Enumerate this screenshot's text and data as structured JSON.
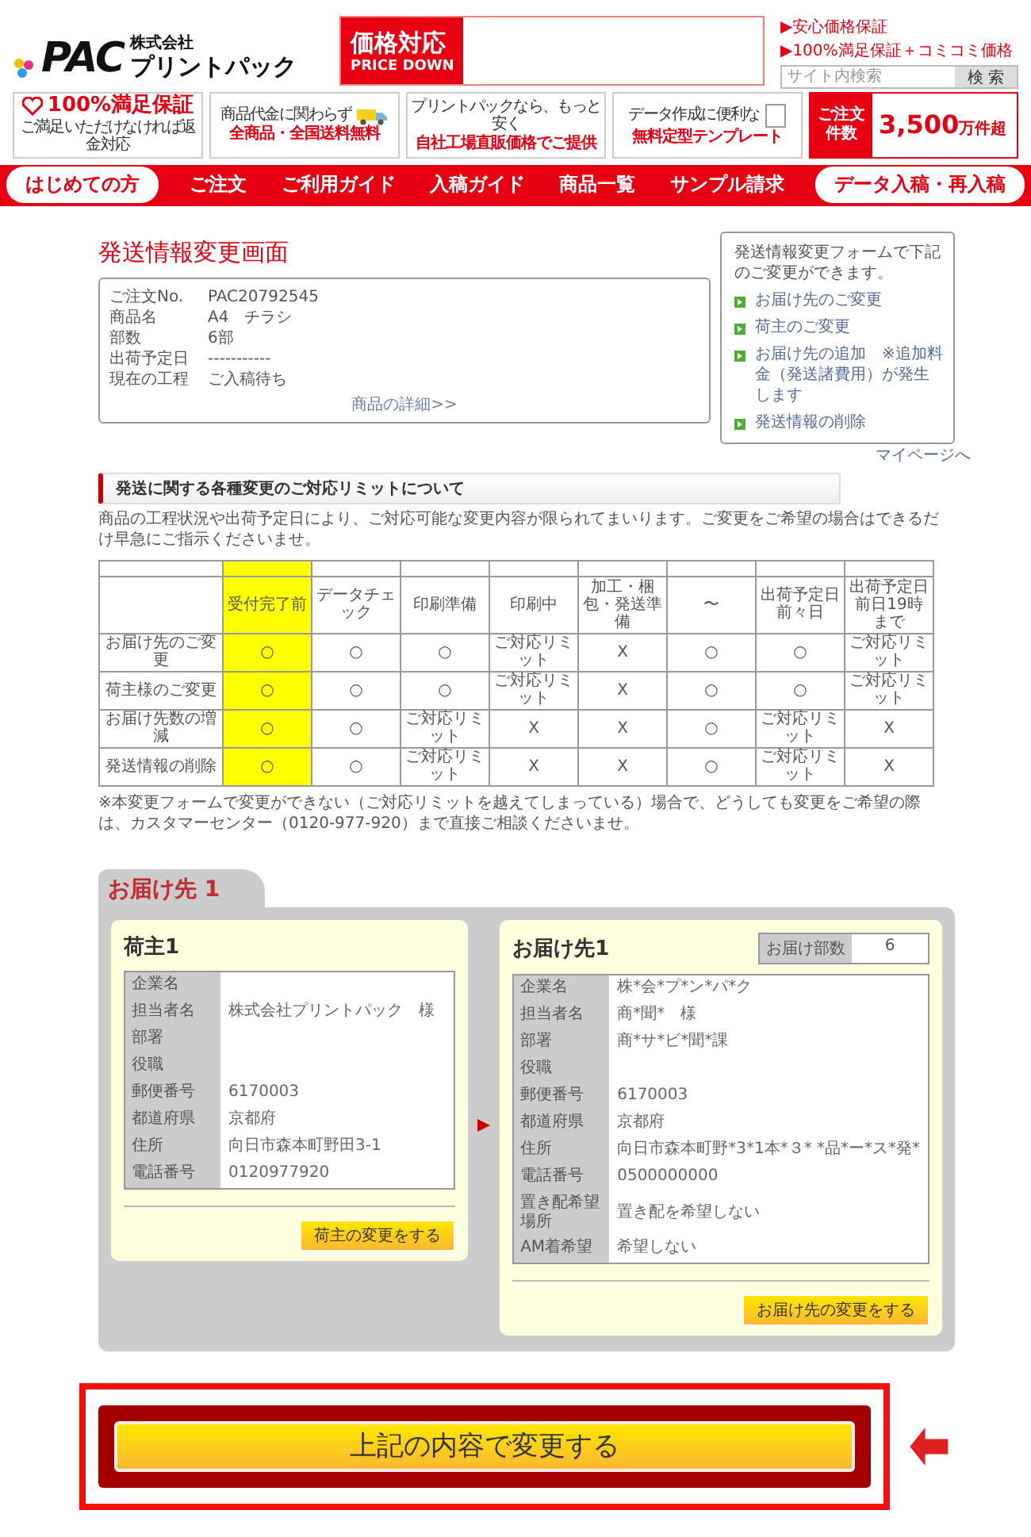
{
  "header": {
    "logo": {
      "company_type": "株式会社",
      "mark": "PAC",
      "name": "プリントパック"
    },
    "price_banner": {
      "title": "価格対応",
      "subtitle": "PRICE DOWN"
    },
    "links": [
      "▶安心価格保証",
      "▶100%満足保証＋コミコミ価格"
    ],
    "search": {
      "placeholder": "サイト内検索",
      "button": "検 索"
    }
  },
  "features": [
    {
      "kind": "guarantee",
      "title": "100%満足保証",
      "text": "ご満足いただけなければ返金対応"
    },
    {
      "kind": "shipping",
      "text": "商品代金に関わらず",
      "title": "全商品・全国送料無料"
    },
    {
      "kind": "price",
      "text": "プリントパックなら、もっと安く",
      "title": "**自社工場直販価格**でご提供"
    },
    {
      "kind": "template",
      "text": "データ作成に便利な",
      "title": "無料定型テンプレート"
    },
    {
      "kind": "orders",
      "label": "ご注文件数",
      "value": "3,500",
      "unit": "万件超"
    }
  ],
  "nav": [
    {
      "kind": "pill",
      "label": "はじめての方"
    },
    {
      "kind": "link",
      "label": "ご注文"
    },
    {
      "kind": "link",
      "label": "ご利用ガイド"
    },
    {
      "kind": "link",
      "label": "入稿ガイド"
    },
    {
      "kind": "link",
      "label": "商品一覧"
    },
    {
      "kind": "link",
      "label": "サンプル請求"
    },
    {
      "kind": "pill",
      "label": "データ入稿・再入稿"
    }
  ],
  "page_title": "発送情報変更画面",
  "order": {
    "rows": [
      {
        "label": "ご注文No.",
        "value": "PAC20792545"
      },
      {
        "label": "商品名",
        "value": "A4　チラシ"
      },
      {
        "label": "部数",
        "value": "6部"
      },
      {
        "label": "出荷予定日",
        "value": "-----------"
      },
      {
        "label": "現在の工程",
        "value": "ご入稿待ち"
      }
    ],
    "detail_link": "商品の詳細>>"
  },
  "side": {
    "intro": "発送情報変更フォームで下記のご変更ができます。",
    "items": [
      "お届け先のご変更",
      "荷主のご変更",
      "お届け先の追加　※追加料金（発送諸費用）が発生します",
      "発送情報の削除"
    ]
  },
  "mypage_link": "マイページへ",
  "section_heading": "発送に関する各種変更のご対応リミットについて",
  "note": "商品の工程状況や出荷予定日により、ご対応可能な変更内容が限られてまいります。ご変更をご希望の場合はできるだけ早急にご指示くださいませ。",
  "table": {
    "columns": [
      {
        "kind": "stage",
        "label": "受付完了前",
        "highlighted": true
      },
      {
        "kind": "stage",
        "label": "データチェック",
        "highlighted": false
      },
      {
        "kind": "stage",
        "label": "印刷準備",
        "highlighted": false
      },
      {
        "kind": "stage",
        "label": "印刷中",
        "highlighted": false
      },
      {
        "kind": "stage",
        "label": "加工・梱包・発送準備",
        "highlighted": false
      },
      {
        "kind": "stage",
        "label": "〜",
        "highlighted": false
      },
      {
        "kind": "stage",
        "label": "出荷予定日前々日",
        "highlighted": false
      },
      {
        "kind": "stage",
        "label": "出荷予定日前日19時まで",
        "highlighted": false
      }
    ],
    "rows": [
      {
        "label": "お届け先のご変更",
        "cells": [
          "○",
          "○",
          "○",
          "ご対応リミット",
          "X",
          "○",
          "○",
          "ご対応リミット"
        ]
      },
      {
        "label": "荷主様のご変更",
        "cells": [
          "○",
          "○",
          "○",
          "ご対応リミット",
          "X",
          "○",
          "○",
          "ご対応リミット"
        ]
      },
      {
        "label": "お届け先数の増減",
        "cells": [
          "○",
          "○",
          "ご対応リミット",
          "X",
          "X",
          "○",
          "ご対応リミット",
          "X"
        ]
      },
      {
        "label": "発送情報の削除",
        "cells": [
          "○",
          "○",
          "ご対応リミット",
          "X",
          "X",
          "○",
          "ご対応リミット",
          "X"
        ]
      }
    ]
  },
  "footnote": "※本変更フォームで変更ができない（ご対応リミットを越えてしまっている）場合で、どうしても変更をご希望の際は、カスタマーセンター（0120-977-920）まで直接ご相談くださいませ。",
  "destination": {
    "tab": "お届け先 1",
    "shipper": {
      "title": "荷主1",
      "rows": [
        {
          "label": "企業名"
        },
        {
          "label": "担当者名",
          "value": "株式会社プリントパック　様"
        },
        {
          "label": "部署"
        },
        {
          "label": "役職"
        },
        {
          "label": "郵便番号",
          "value": "6170003"
        },
        {
          "label": "都道府県",
          "value": "京都府"
        },
        {
          "label": "住所",
          "value": "向日市森本町野田3-1"
        },
        {
          "label": "電話番号",
          "value": "0120977920"
        }
      ],
      "button": "荷主の変更をする"
    },
    "recipient": {
      "title": "お届け先1",
      "copies_label": "お届け部数",
      "copies": "6",
      "rows": [
        {
          "label": "企業名",
          "value": "株*会*プ*ン*パ*ク"
        },
        {
          "label": "担当者名",
          "value": "商*聞*　様"
        },
        {
          "label": "部署",
          "value": "商*サ*ビ*聞*課"
        },
        {
          "label": "役職"
        },
        {
          "label": "郵便番号",
          "value": "6170003"
        },
        {
          "label": "都道府県",
          "value": "京都府"
        },
        {
          "label": "住所",
          "value": "向日市森本町野*3*1本*３*  *品*ー*ス*発*"
        },
        {
          "label": "電話番号",
          "value": "0500000000"
        },
        {
          "label": "置き配希望場所",
          "value": "置き配を希望しない"
        },
        {
          "label": "AM着希望",
          "value": "希望しない"
        }
      ],
      "button": "お届け先の変更をする"
    }
  },
  "submit": "上記の内容で変更する"
}
